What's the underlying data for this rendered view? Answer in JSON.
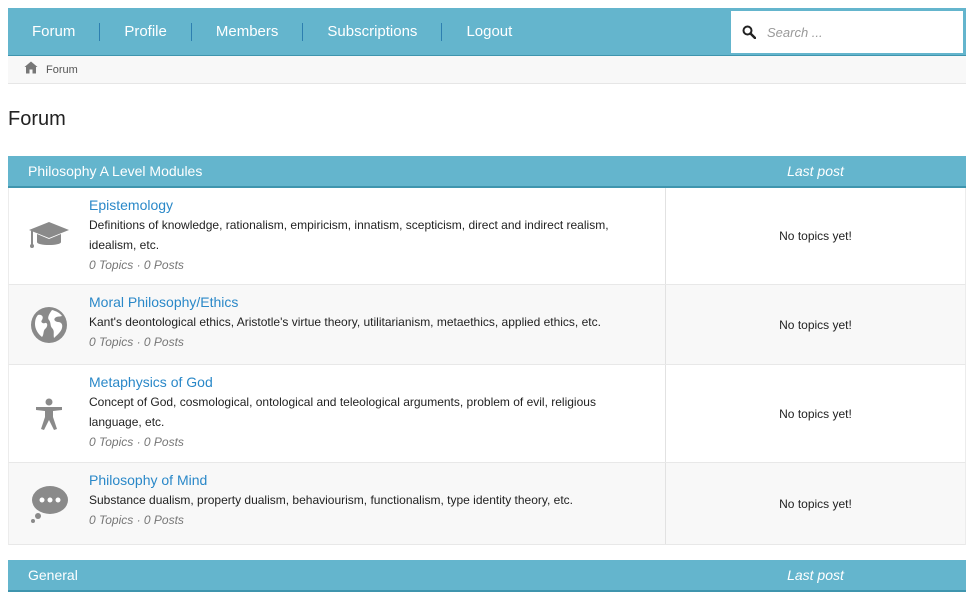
{
  "nav": {
    "links": [
      "Forum",
      "Profile",
      "Members",
      "Subscriptions",
      "Logout"
    ],
    "search_placeholder": "Search ..."
  },
  "breadcrumb": {
    "home_icon": "home-icon",
    "current": "Forum"
  },
  "page_title": "Forum",
  "categories": [
    {
      "title": "Philosophy A Level Modules",
      "last_post_header": "Last post",
      "forums": [
        {
          "icon": "graduation-cap-icon",
          "title": "Epistemology",
          "description": "Definitions of knowledge, rationalism, empiricism, innatism, scepticism, direct and indirect realism, idealism, etc.",
          "stats": "0 Topics · 0 Posts",
          "last_post": "No topics yet!"
        },
        {
          "icon": "globe-icon",
          "title": "Moral Philosophy/Ethics",
          "description": "Kant's deontological ethics, Aristotle's virtue theory, utilitarianism, metaethics, applied ethics, etc.",
          "stats": "0 Topics · 0 Posts",
          "last_post": "No topics yet!"
        },
        {
          "icon": "universal-access-icon",
          "title": "Metaphysics of God",
          "description": "Concept of God, cosmological, ontological and teleological arguments, problem of evil, religious language, etc.",
          "stats": "0 Topics · 0 Posts",
          "last_post": "No topics yet!"
        },
        {
          "icon": "thought-bubble-icon",
          "title": "Philosophy of Mind",
          "description": "Substance dualism, property dualism, behaviourism, functionalism, type identity theory, etc.",
          "stats": "0 Topics · 0 Posts",
          "last_post": "No topics yet!"
        }
      ]
    },
    {
      "title": "General",
      "last_post_header": "Last post",
      "forums": []
    }
  ],
  "colors": {
    "header_bg": "#64b5cd",
    "link": "#2a88c8",
    "icon": "#8a8a8a"
  }
}
